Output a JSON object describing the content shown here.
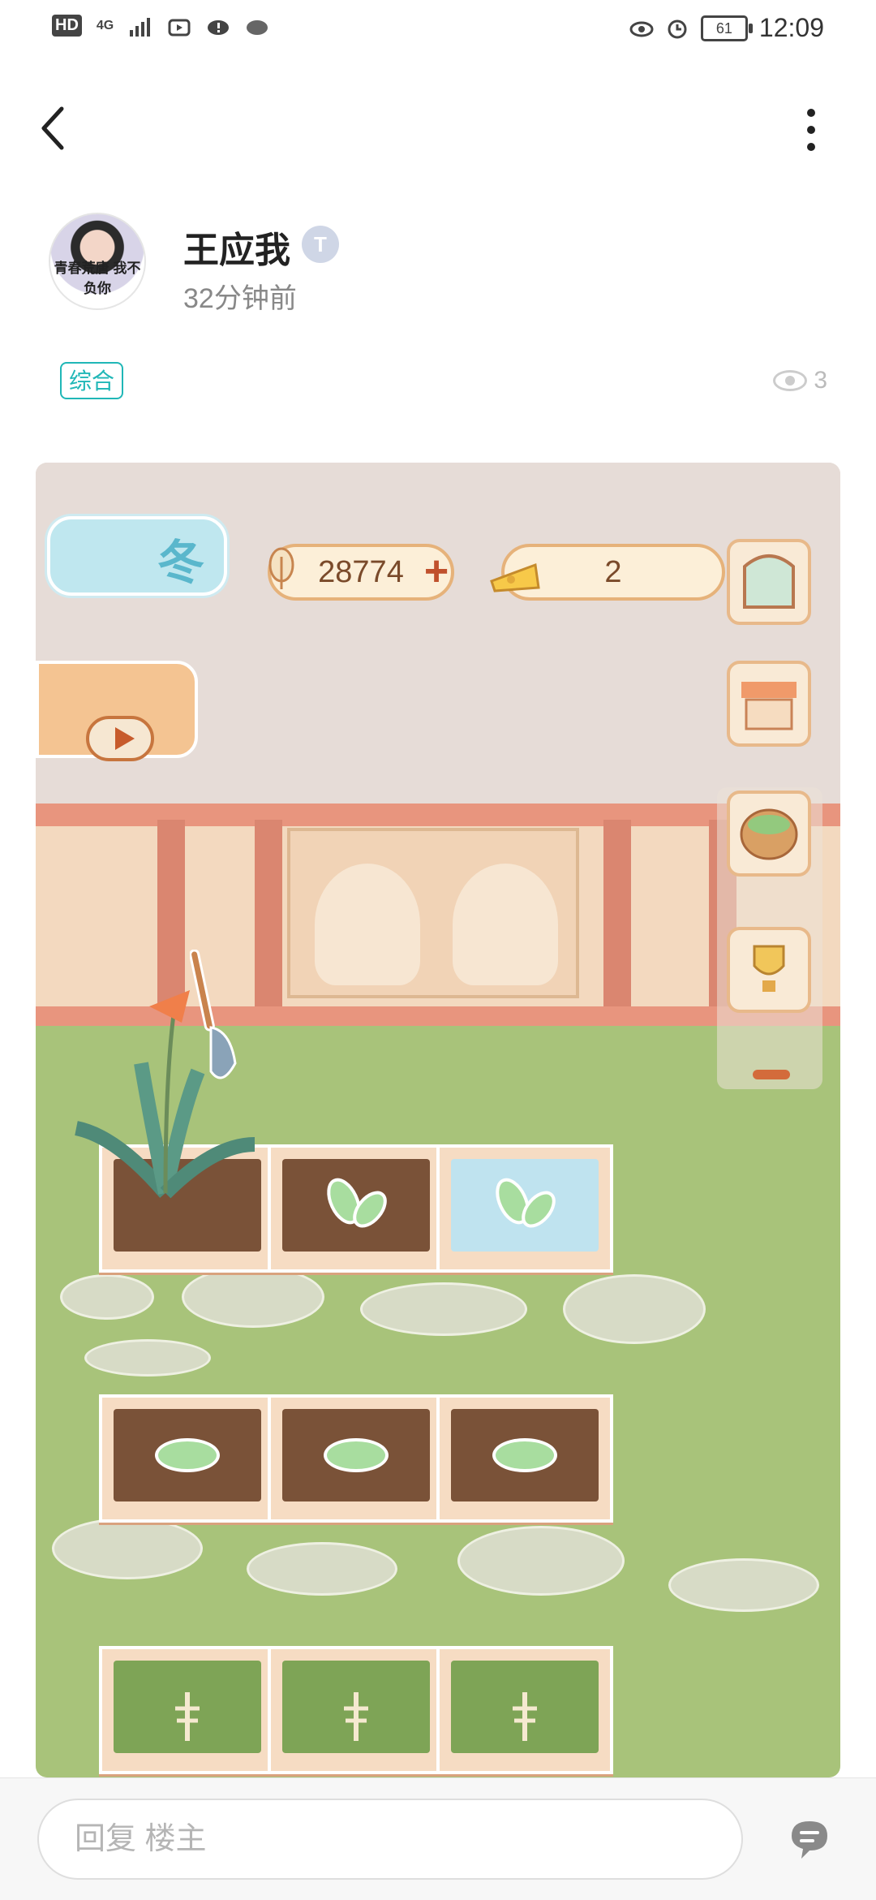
{
  "status_bar": {
    "hd": "HD",
    "network": "4G",
    "battery": "61",
    "time": "12:09"
  },
  "nav": {
    "back_icon": "chevron-left-icon",
    "more_icon": "vertical-dots-icon"
  },
  "author": {
    "avatar_text": "青春荒唐 我不负你",
    "name": "王应我",
    "badge": "T",
    "time_ago": "32分钟前"
  },
  "post": {
    "tag": "综合",
    "views": "3"
  },
  "game": {
    "season_label": "冬",
    "fish_count": "28774",
    "cheese_count": "2",
    "plots": [
      {
        "state": "grown-plant"
      },
      {
        "state": "sprout"
      },
      {
        "state": "sprout-watered"
      },
      {
        "state": "seedling"
      },
      {
        "state": "seedling"
      },
      {
        "state": "seedling"
      },
      {
        "state": "fishbone"
      },
      {
        "state": "fishbone"
      },
      {
        "state": "fishbone"
      }
    ],
    "colors": {
      "lawn": "#a8c37a",
      "fence": "#e8957e",
      "soil": "#7a5238"
    }
  },
  "reply": {
    "placeholder": "回复  楼主",
    "comment_icon": "comment-bubble-icon"
  }
}
